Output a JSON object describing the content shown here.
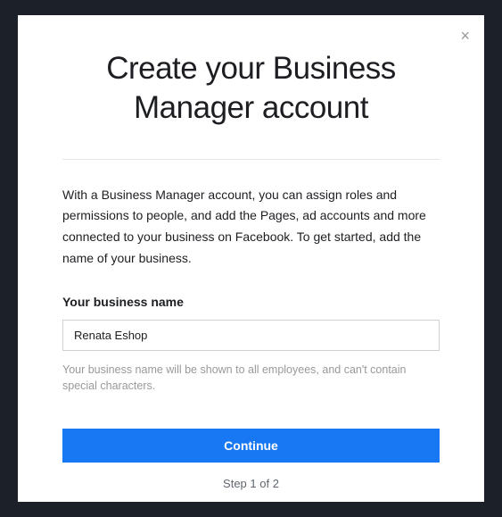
{
  "modal": {
    "title": "Create your Business Manager account",
    "description": "With a Business Manager account, you can assign roles and permissions to people, and add the Pages, ad accounts and more connected to your business on Facebook. To get started, add the name of your business.",
    "close_symbol": "×"
  },
  "form": {
    "label": "Your business name",
    "value": "Renata Eshop",
    "hint": "Your business name will be shown to all employees, and can't contain special characters."
  },
  "actions": {
    "continue_label": "Continue",
    "step_text": "Step 1 of 2"
  }
}
